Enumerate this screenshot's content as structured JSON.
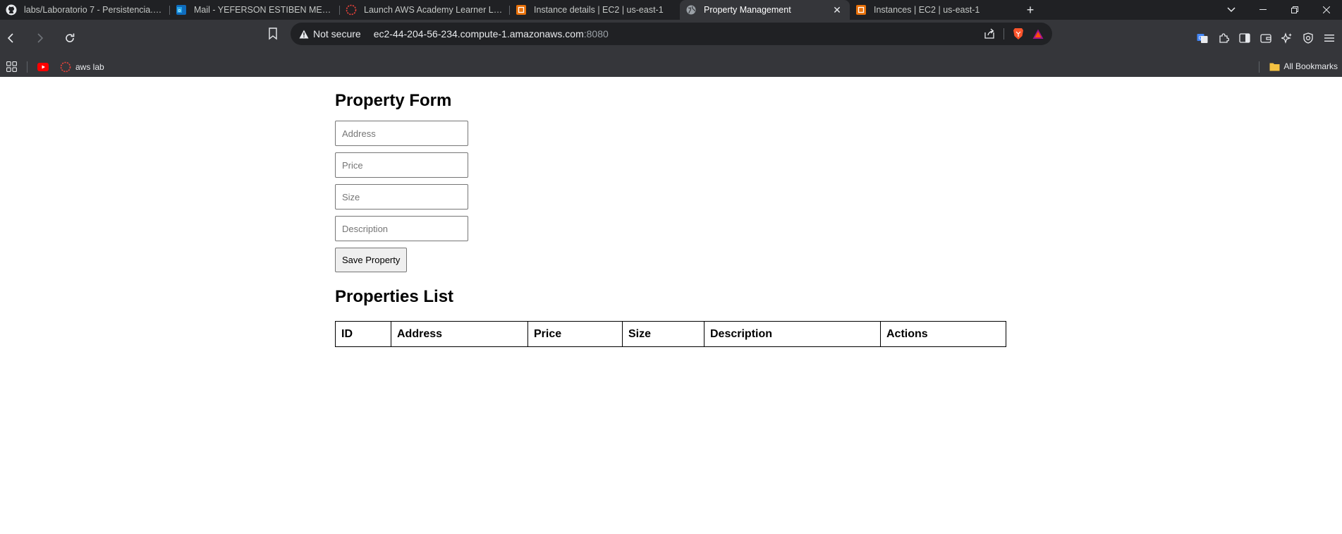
{
  "browser": {
    "tabs": [
      {
        "title": "labs/Laboratorio 7 - Persistencia.md",
        "icon": "github-icon",
        "active": false
      },
      {
        "title": "Mail - YEFERSON ESTIBEN MESA VA",
        "icon": "outlook-icon",
        "active": false
      },
      {
        "title": "Launch AWS Academy Learner Lab",
        "icon": "aws-academy-icon",
        "active": false
      },
      {
        "title": "Instance details | EC2 | us-east-1",
        "icon": "aws-ec2-icon",
        "active": false
      },
      {
        "title": "Property Management",
        "icon": "globe-icon",
        "active": true
      },
      {
        "title": "Instances | EC2 | us-east-1",
        "icon": "aws-ec2-icon",
        "active": false
      }
    ],
    "security_label": "Not secure",
    "url_host": "ec2-44-204-56-234.compute-1.amazonaws.com",
    "url_port": ":8080",
    "bookmarks": [
      {
        "label": "",
        "icon": "youtube-icon"
      },
      {
        "label": "aws lab",
        "icon": "aws-academy-icon"
      }
    ],
    "all_bookmarks_label": "All Bookmarks"
  },
  "form": {
    "title": "Property Form",
    "address_placeholder": "Address",
    "price_placeholder": "Price",
    "size_placeholder": "Size",
    "description_placeholder": "Description",
    "save_label": "Save Property"
  },
  "list": {
    "title": "Properties List",
    "columns": [
      "ID",
      "Address",
      "Price",
      "Size",
      "Description",
      "Actions"
    ],
    "rows": []
  },
  "colors": {
    "tabstrip_bg": "#202124",
    "toolbar_bg": "#35363a",
    "omnibox_bg": "#202124",
    "aws_orange": "#e8710a",
    "brave_orange": "#fb542b"
  }
}
